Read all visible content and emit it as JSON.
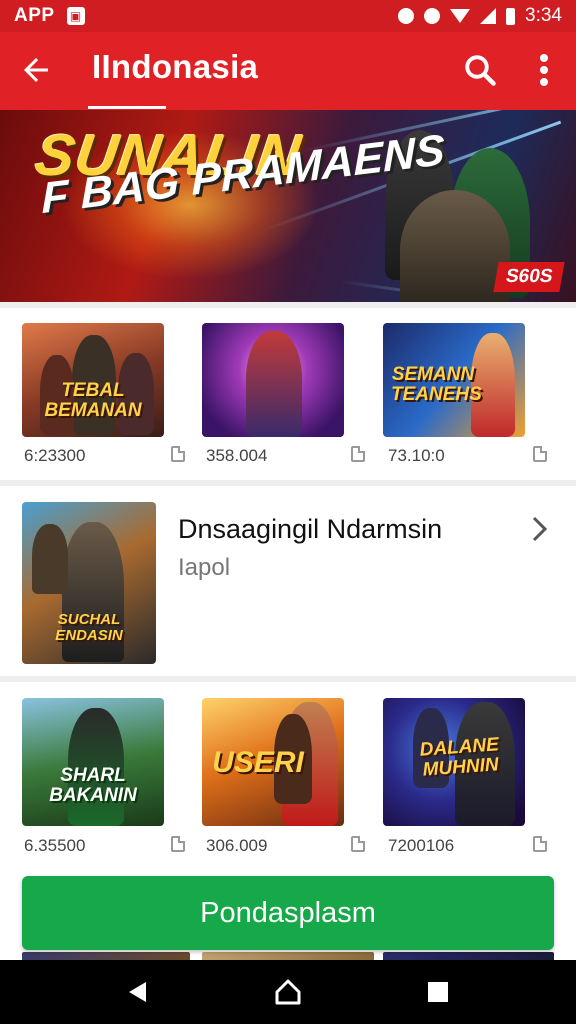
{
  "status_bar": {
    "app_label": "APP",
    "time": "3:34"
  },
  "app_bar": {
    "title": "IIndonasia"
  },
  "hero": {
    "headline": "SUNALIN",
    "subheadline": "F BAG PRAMAENS",
    "badge": "S60S"
  },
  "row1": {
    "tiles": [
      {
        "art_title": "TEBAL BEMANAN",
        "caption": "6:23300"
      },
      {
        "art_title": "",
        "caption": "358.004"
      },
      {
        "art_title": "SEMANN TEANEHS",
        "caption": "73.10:0"
      }
    ]
  },
  "feature": {
    "art_title": "SUCHAL ENDASIN",
    "name": "Dnsaagingil Ndarmsin",
    "sub": "Iapol"
  },
  "row2": {
    "tiles": [
      {
        "art_title": "SHARL BAKANIN",
        "caption": "6.35500"
      },
      {
        "art_title": "USERI",
        "caption": "306.009"
      },
      {
        "art_title": "DALANE MUHNIN",
        "caption": "7200106"
      }
    ]
  },
  "cta": {
    "label": "Pondasplasm"
  },
  "colors": {
    "primary_red": "#e02126",
    "status_red": "#d01d22",
    "cta_green": "#17a84a"
  },
  "icons": [
    "back-arrow-icon",
    "search-icon",
    "more-vert-icon",
    "chevron-right-icon",
    "document-icon",
    "nav-back-icon",
    "nav-home-icon",
    "nav-recents-icon"
  ]
}
